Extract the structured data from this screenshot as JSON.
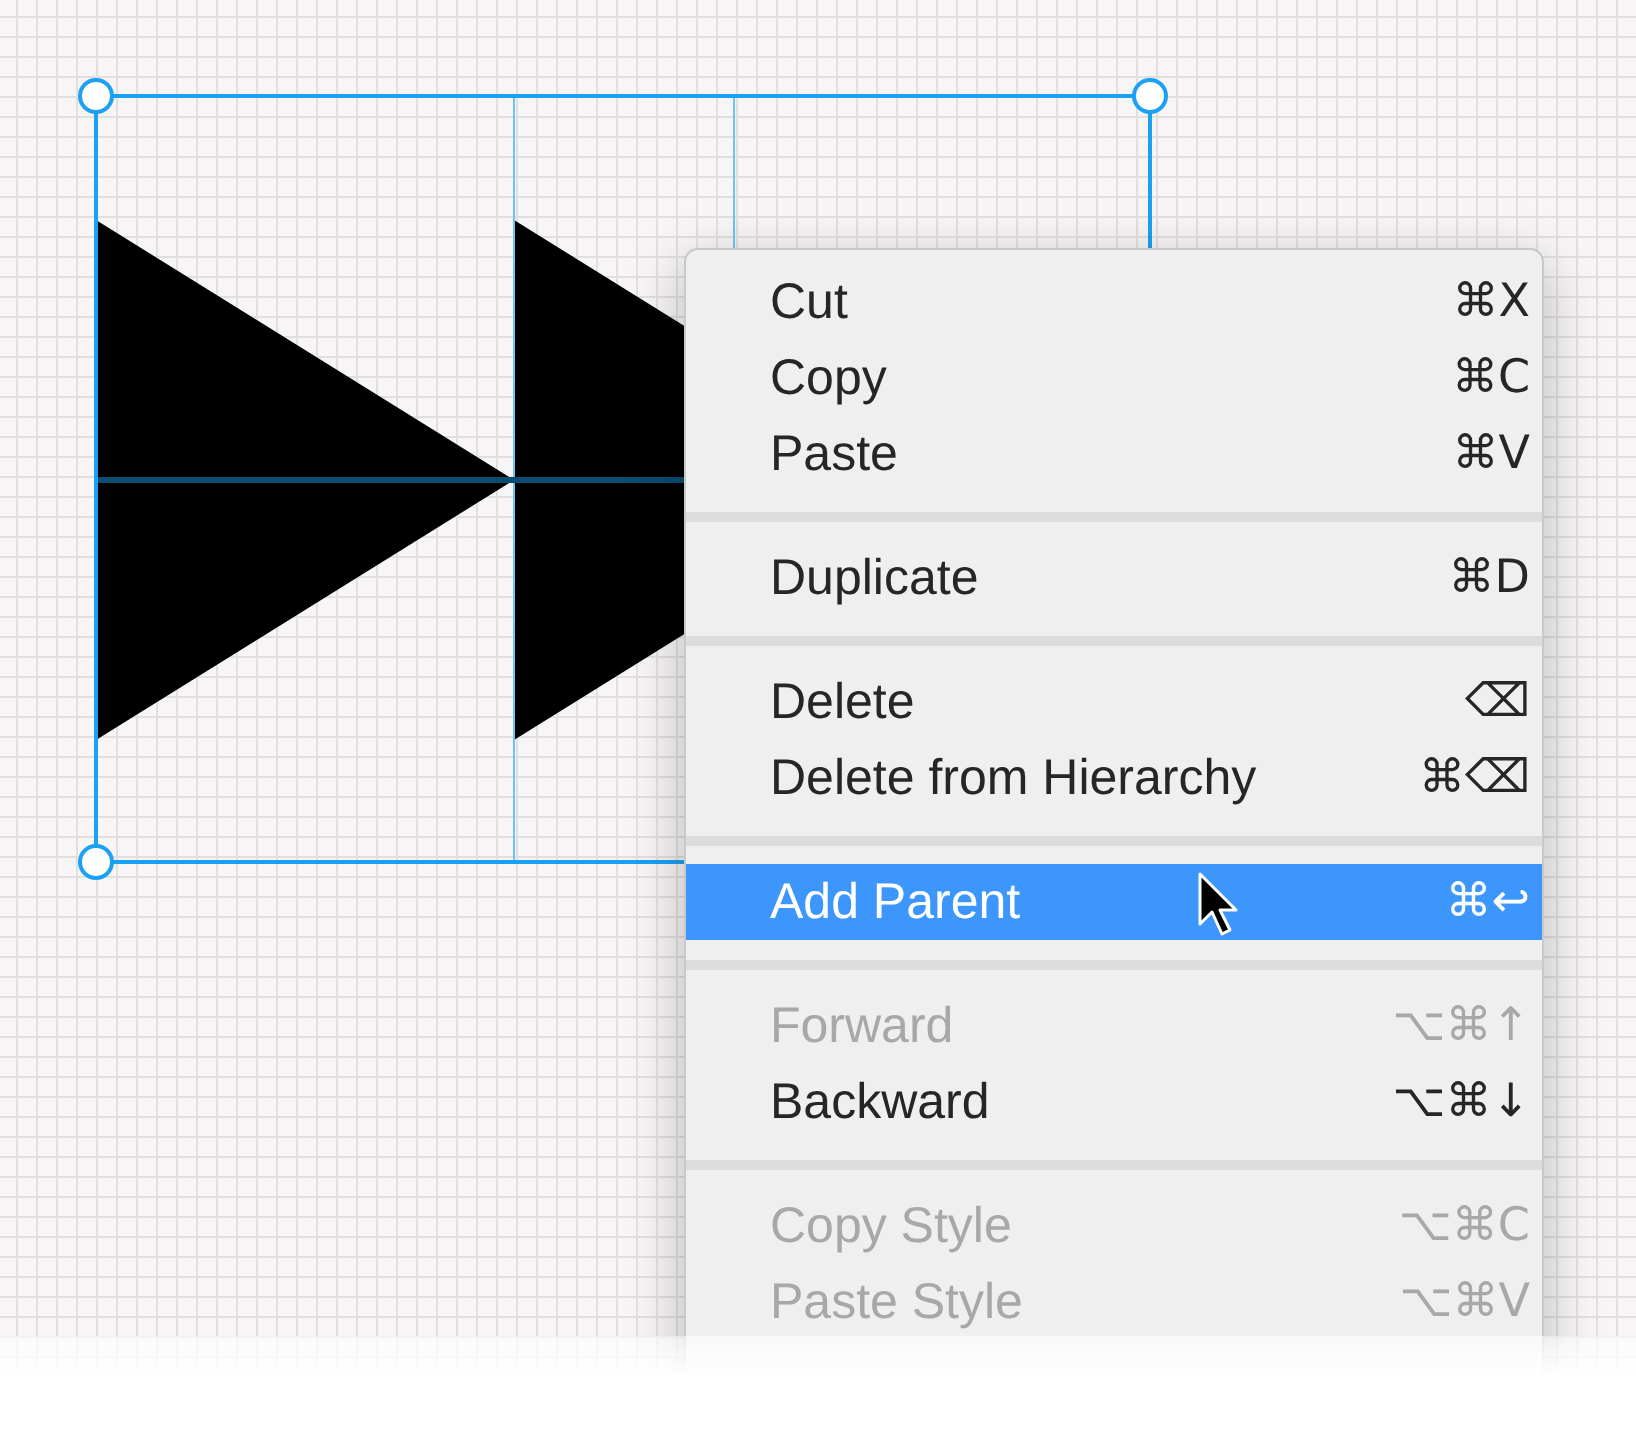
{
  "context_menu": {
    "sections": [
      {
        "items": [
          {
            "label": "Cut",
            "shortcut": "⌘X",
            "disabled": false,
            "selected": false
          },
          {
            "label": "Copy",
            "shortcut": "⌘C",
            "disabled": false,
            "selected": false
          },
          {
            "label": "Paste",
            "shortcut": "⌘V",
            "disabled": false,
            "selected": false
          }
        ]
      },
      {
        "items": [
          {
            "label": "Duplicate",
            "shortcut": "⌘D",
            "disabled": false,
            "selected": false
          }
        ]
      },
      {
        "items": [
          {
            "label": "Delete",
            "shortcut": "⌫",
            "disabled": false,
            "selected": false
          },
          {
            "label": "Delete from Hierarchy",
            "shortcut": "⌘⌫",
            "disabled": false,
            "selected": false
          }
        ]
      },
      {
        "items": [
          {
            "label": "Add Parent",
            "shortcut": "⌘↩",
            "disabled": false,
            "selected": true
          }
        ]
      },
      {
        "items": [
          {
            "label": "Forward",
            "shortcut": "⌥⌘↑",
            "disabled": true,
            "selected": false
          },
          {
            "label": "Backward",
            "shortcut": "⌥⌘↓",
            "disabled": false,
            "selected": false
          }
        ]
      },
      {
        "items": [
          {
            "label": "Copy Style",
            "shortcut": "⌥⌘C",
            "disabled": true,
            "selected": false
          },
          {
            "label": "Paste Style",
            "shortcut": "⌥⌘V",
            "disabled": true,
            "selected": false
          }
        ]
      }
    ]
  }
}
